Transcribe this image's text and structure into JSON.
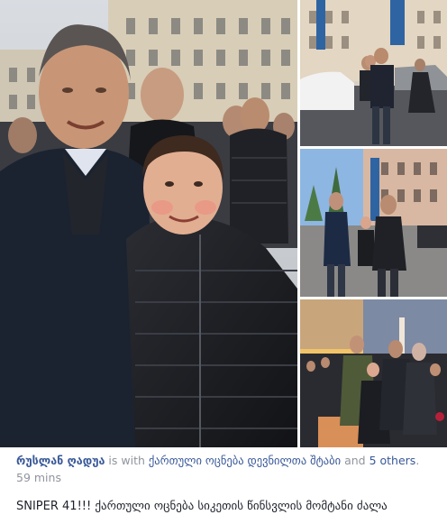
{
  "post": {
    "author": "რუსლან ღადუა",
    "with_text": "is with",
    "tagged_page": "ქართული ოცნება დევნილთა შტაბი",
    "and_text": "and",
    "others": "5 others",
    "period": ".",
    "timestamp": "59 mins",
    "body_text": "SNIPER 41!!! ქართული ოცნება სიკეთის წინსვლის მომტანი ძალა"
  },
  "photos": [
    {
      "name": "main-photo",
      "description_visible": false
    },
    {
      "name": "side-photo-1",
      "description_visible": false
    },
    {
      "name": "side-photo-2",
      "description_visible": false
    },
    {
      "name": "side-photo-3",
      "description_visible": false
    }
  ],
  "colors": {
    "link": "#385898",
    "muted": "#90949c",
    "text": "#1d2129"
  }
}
